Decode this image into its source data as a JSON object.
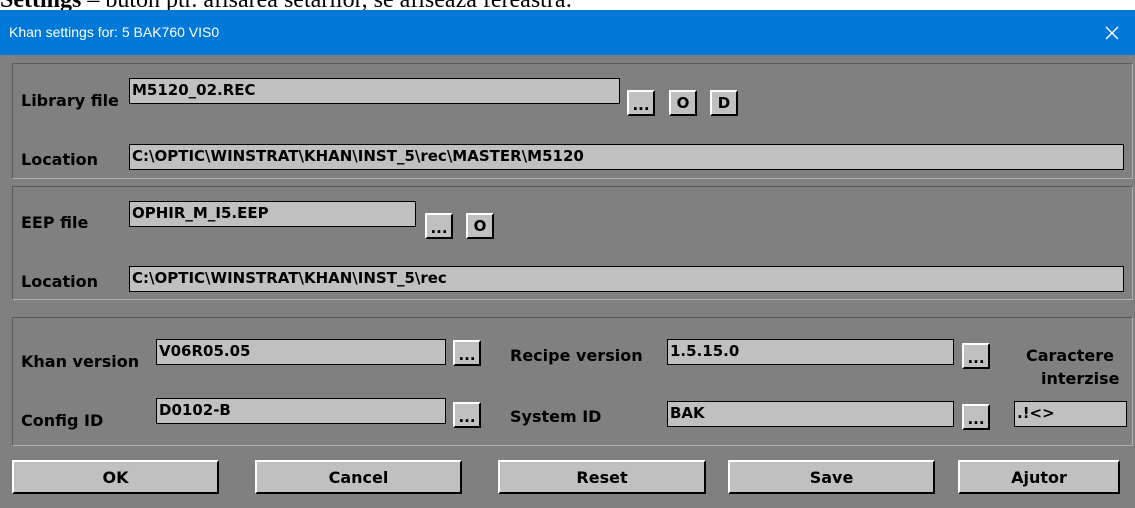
{
  "doc_text": {
    "bold": "Settings",
    "rest": " – buton ptr. afisarea setarilor, se afiseaza fereastra:"
  },
  "window": {
    "title": "Khan settings for: 5  BAK760 VIS0",
    "close_icon": "close-icon",
    "titlebar_color": "#0078d7",
    "face_color": "#808080",
    "field_color": "#c0c0c0"
  },
  "library": {
    "label": "Library file",
    "value": "M5120_02.REC",
    "browse_label": "...",
    "o_label": "O",
    "d_label": "D",
    "location_label": "Location",
    "location_value": "C:\\OPTIC\\WINSTRAT\\KHAN\\INST_5\\rec\\MASTER\\M5120"
  },
  "eep": {
    "label": "EEP file",
    "value": "OPHIR_M_I5.EEP",
    "browse_label": "...",
    "o_label": "O",
    "location_label": "Location",
    "location_value": "C:\\OPTIC\\WINSTRAT\\KHAN\\INST_5\\rec"
  },
  "versions": {
    "khan_label": "Khan version",
    "khan_value": "V06R05.05",
    "khan_browse": "...",
    "recipe_label": "Recipe version",
    "recipe_value": "1.5.15.0",
    "recipe_browse": "...",
    "chars_label_line1": "Caractere",
    "chars_label_line2": "interzise",
    "config_label": "Config ID",
    "config_value": "D0102-B",
    "config_browse": "...",
    "system_label": "System ID",
    "system_value": "BAK",
    "system_browse": "...",
    "chars_value": ".!<>"
  },
  "buttons": {
    "ok": "OK",
    "cancel": "Cancel",
    "reset": "Reset",
    "save": "Save",
    "help": "Ajutor"
  }
}
